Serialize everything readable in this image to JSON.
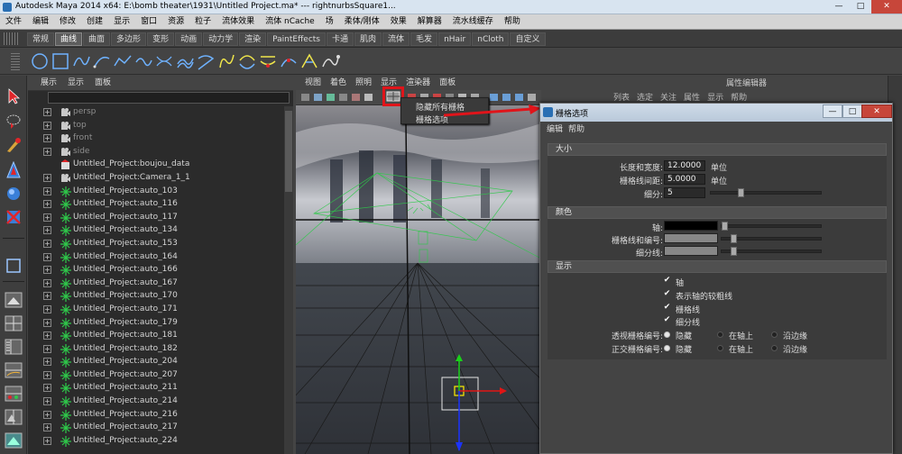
{
  "window": {
    "title": "Autodesk Maya 2014 x64: E:\\bomb theater\\1931\\Untitled Project.ma*    ---    rightnurbsSquare1...",
    "min": "—",
    "max": "□",
    "close": "✕"
  },
  "menubar": [
    "文件",
    "编辑",
    "修改",
    "创建",
    "显示",
    "窗口",
    "资源",
    "粒子",
    "流体效果",
    "流体 nCache",
    "场",
    "柔体/刚体",
    "效果",
    "解算器",
    "流水线缓存",
    "帮助"
  ],
  "shelf_tabs": [
    "常规",
    "曲线",
    "曲面",
    "多边形",
    "变形",
    "动画",
    "动力学",
    "渲染",
    "PaintEffects",
    "卡通",
    "肌肉",
    "流体",
    "毛发",
    "nHair",
    "nCloth",
    "自定义"
  ],
  "shelf_active_tab": "曲线",
  "shelf_icon_count": 15,
  "outliner": {
    "menu": [
      "展示",
      "显示",
      "面板"
    ],
    "items": [
      {
        "label": "persp",
        "type": "camera",
        "dim": true,
        "expand": true
      },
      {
        "label": "top",
        "type": "camera",
        "dim": true,
        "expand": true
      },
      {
        "label": "front",
        "type": "camera",
        "dim": true,
        "expand": true
      },
      {
        "label": "side",
        "type": "camera",
        "dim": true,
        "expand": true
      },
      {
        "label": "Untitled_Project:boujou_data",
        "type": "node",
        "dim": false,
        "expand": false
      },
      {
        "label": "Untitled_Project:Camera_1_1",
        "type": "camera",
        "dim": false,
        "expand": true
      },
      {
        "label": "Untitled_Project:auto_103",
        "type": "locator",
        "dim": false,
        "expand": true
      },
      {
        "label": "Untitled_Project:auto_116",
        "type": "locator",
        "dim": false,
        "expand": true
      },
      {
        "label": "Untitled_Project:auto_117",
        "type": "locator",
        "dim": false,
        "expand": true
      },
      {
        "label": "Untitled_Project:auto_134",
        "type": "locator",
        "dim": false,
        "expand": true
      },
      {
        "label": "Untitled_Project:auto_153",
        "type": "locator",
        "dim": false,
        "expand": true
      },
      {
        "label": "Untitled_Project:auto_164",
        "type": "locator",
        "dim": false,
        "expand": true
      },
      {
        "label": "Untitled_Project:auto_166",
        "type": "locator",
        "dim": false,
        "expand": true
      },
      {
        "label": "Untitled_Project:auto_167",
        "type": "locator",
        "dim": false,
        "expand": true
      },
      {
        "label": "Untitled_Project:auto_170",
        "type": "locator",
        "dim": false,
        "expand": true
      },
      {
        "label": "Untitled_Project:auto_171",
        "type": "locator",
        "dim": false,
        "expand": true
      },
      {
        "label": "Untitled_Project:auto_179",
        "type": "locator",
        "dim": false,
        "expand": true
      },
      {
        "label": "Untitled_Project:auto_181",
        "type": "locator",
        "dim": false,
        "expand": true
      },
      {
        "label": "Untitled_Project:auto_182",
        "type": "locator",
        "dim": false,
        "expand": true
      },
      {
        "label": "Untitled_Project:auto_204",
        "type": "locator",
        "dim": false,
        "expand": true
      },
      {
        "label": "Untitled_Project:auto_207",
        "type": "locator",
        "dim": false,
        "expand": true
      },
      {
        "label": "Untitled_Project:auto_211",
        "type": "locator",
        "dim": false,
        "expand": true
      },
      {
        "label": "Untitled_Project:auto_214",
        "type": "locator",
        "dim": false,
        "expand": true
      },
      {
        "label": "Untitled_Project:auto_216",
        "type": "locator",
        "dim": false,
        "expand": true
      },
      {
        "label": "Untitled_Project:auto_217",
        "type": "locator",
        "dim": false,
        "expand": true
      },
      {
        "label": "Untitled_Project:auto_224",
        "type": "locator",
        "dim": false,
        "expand": true
      }
    ]
  },
  "viewport": {
    "menu": [
      "视图",
      "着色",
      "照明",
      "显示",
      "渲染器",
      "面板"
    ]
  },
  "grid_context_menu": {
    "items": [
      "隐藏所有栅格",
      "栅格选项"
    ]
  },
  "attribute_editor": {
    "title": "属性编辑器",
    "tabs": [
      "列表",
      "选定",
      "关注",
      "属性",
      "显示",
      "帮助"
    ]
  },
  "grid_options": {
    "title": "栅格选项",
    "menu": [
      "编辑",
      "帮助"
    ],
    "size_section": {
      "header": "大小",
      "length_width_label": "长度和宽度:",
      "length_width_value": "12.0000",
      "length_width_unit": "单位",
      "spacing_label": "栅格线间距:",
      "spacing_value": "5.0000",
      "spacing_unit": "单位",
      "subdiv_label": "细分:",
      "subdiv_value": "5"
    },
    "color_section": {
      "header": "颜色",
      "axis_label": "轴:",
      "gridlines_label": "栅格线和编号:",
      "subdiv_label": "细分线:",
      "axis_color": "#000000",
      "gridlines_color": "#878787",
      "subdiv_color": "#878787"
    },
    "display_section": {
      "header": "显示",
      "checks": [
        "轴",
        "表示轴的较粗线",
        "栅格线",
        "细分线"
      ],
      "persp_label": "透视栅格编号:",
      "ortho_label": "正交栅格编号:",
      "radio_options": [
        "隐藏",
        "在轴上",
        "沿边缘"
      ],
      "selected_option": "隐藏"
    }
  },
  "colors": {
    "highlight_red": "#e0141a",
    "locator_green": "#2fc84a",
    "manip_y_green": "#1ad11a",
    "manip_x_red": "#e01515",
    "manip_z_blue": "#1b33ff"
  }
}
